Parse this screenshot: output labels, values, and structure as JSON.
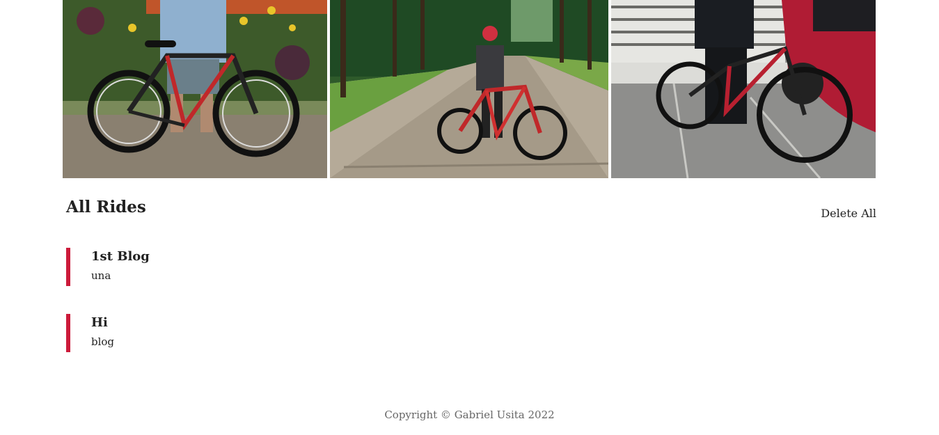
{
  "gallery": {
    "photos": [
      {
        "icon": "bike-photo-1"
      },
      {
        "icon": "bike-photo-2"
      },
      {
        "icon": "bike-photo-3"
      }
    ]
  },
  "rides_section": {
    "title": "All Rides",
    "delete_all_label": "Delete All",
    "items": [
      {
        "title": "1st Blog",
        "body": "una"
      },
      {
        "title": "Hi",
        "body": "blog"
      }
    ],
    "accent_color": "#cc1a3a"
  },
  "footer": {
    "copyright": "Copyright © Gabriel Usita 2022"
  }
}
